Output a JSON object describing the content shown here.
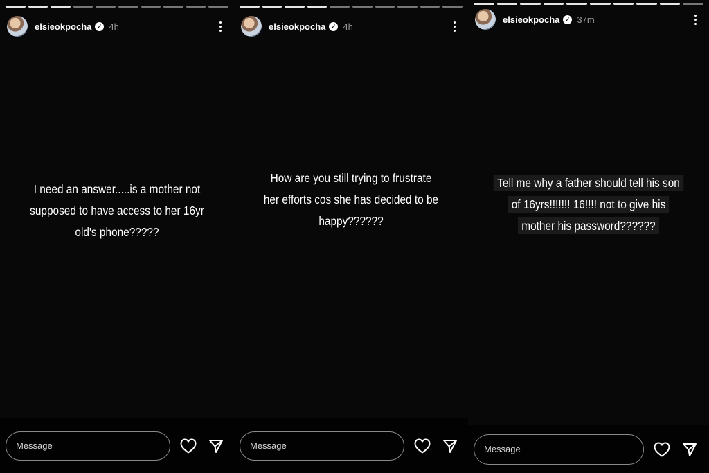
{
  "stories": [
    {
      "username": "elsieokpocha",
      "time": "4h",
      "caption_lines": [
        "I need an answer.....is a mother not",
        "supposed to have access to her 16yr",
        "old's phone?????"
      ],
      "message_placeholder": "Message"
    },
    {
      "username": "elsieokpocha",
      "time": "4h",
      "caption_lines": [
        "How are you still trying to frustrate",
        "her efforts cos she has decided to be",
        "happy??????"
      ],
      "message_placeholder": "Message"
    },
    {
      "username": "elsieokpocha",
      "time": "37m",
      "caption_lines": [
        "Tell me why a father should tell his son",
        "of 16yrs!!!!!!! 16!!!! not to give his",
        "mother his password??????"
      ],
      "message_placeholder": "Message"
    }
  ],
  "icons": {
    "verified": "verified-badge-icon",
    "more": "more-options-icon",
    "like": "heart-icon",
    "share": "send-icon",
    "avatar": "profile-avatar"
  },
  "colors": {
    "background": "#080808",
    "text": "#ffffff",
    "muted": "#9a9a9a",
    "input_border": "#8a8a8a"
  }
}
